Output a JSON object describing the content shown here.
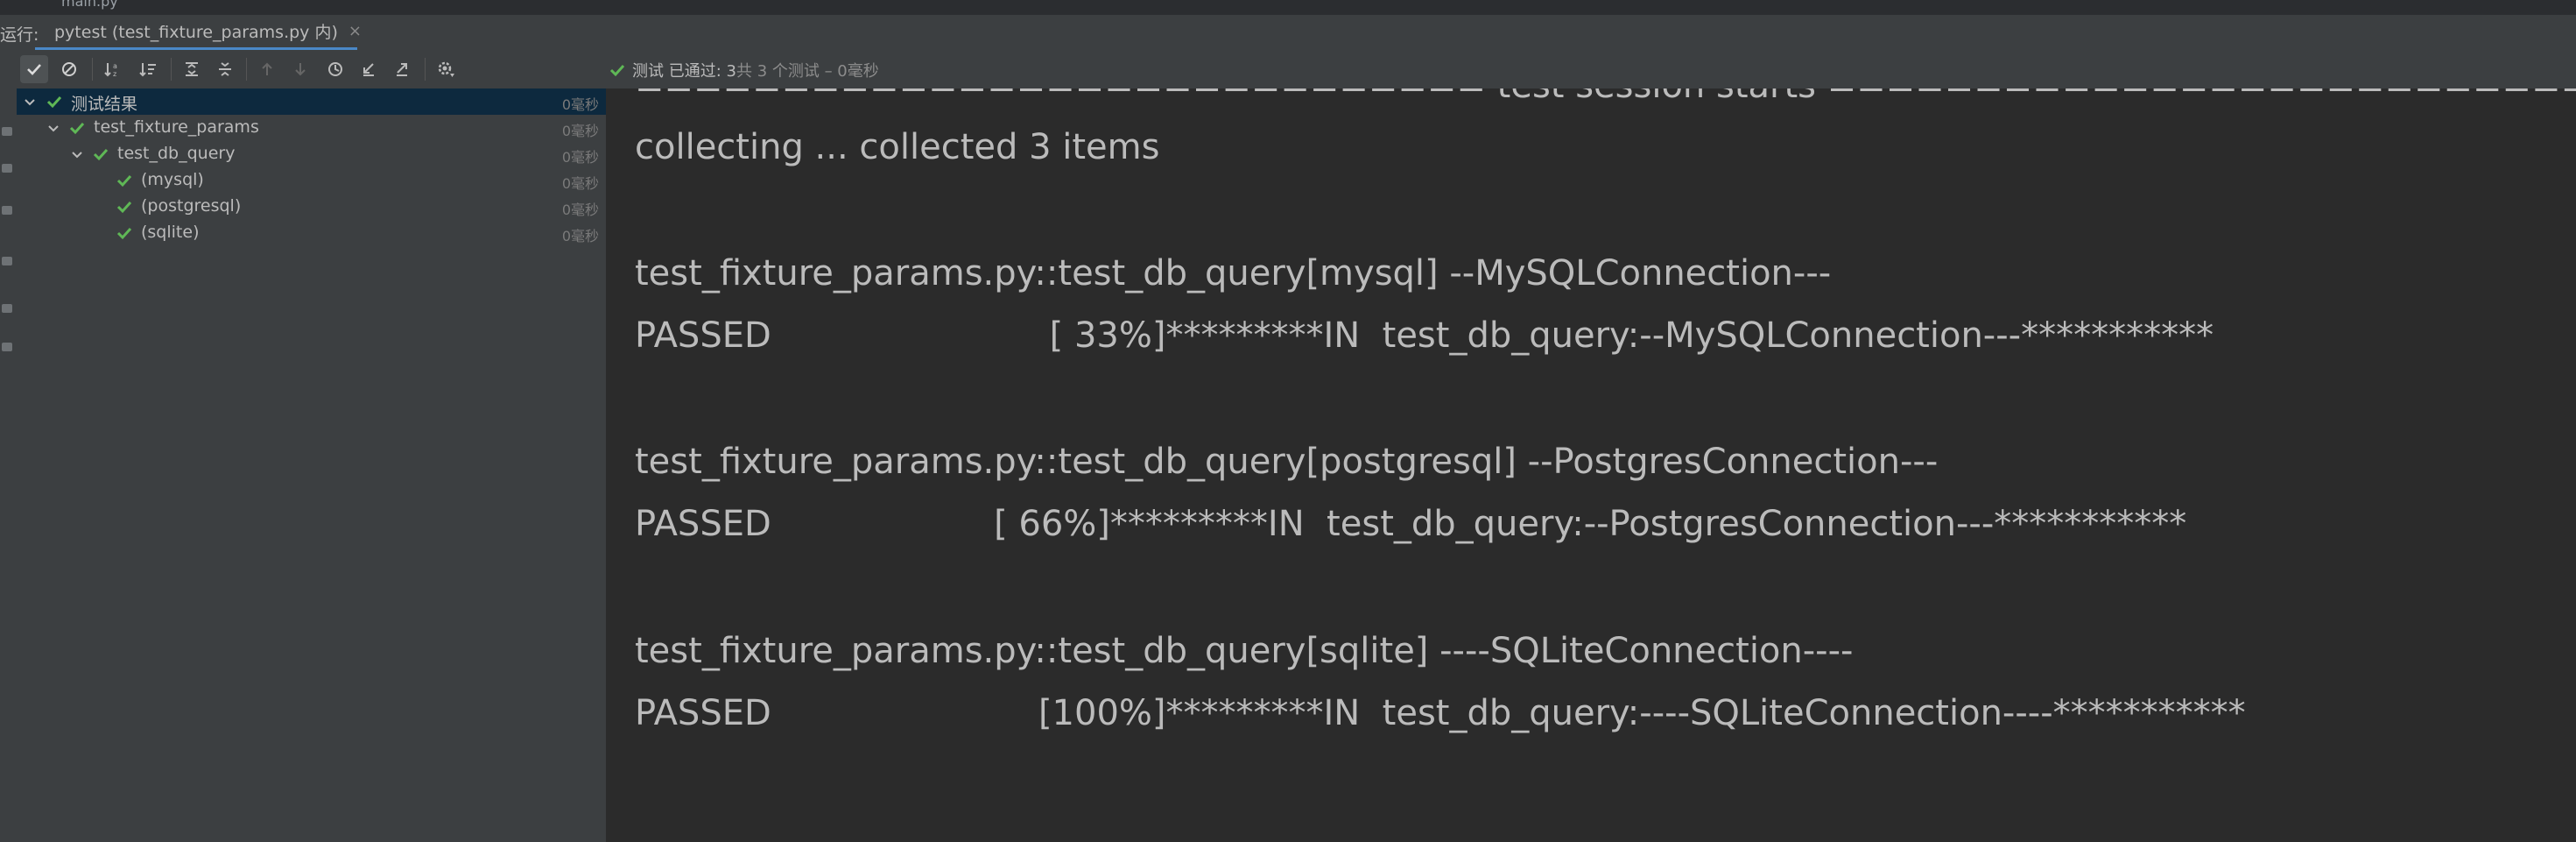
{
  "topstrip": {
    "file_label": "main.py"
  },
  "tabbar": {
    "run_label": "运行:",
    "tab": {
      "title": "pytest (test_fixture_params.py 内)",
      "close_glyph": "×"
    }
  },
  "toolbar": {
    "buttons": [
      {
        "name": "show-passed-icon"
      },
      {
        "name": "show-ignored-icon"
      },
      {
        "name": "sort-alphabetically-icon"
      },
      {
        "name": "sort-by-duration-icon"
      },
      {
        "name": "expand-all-icon"
      },
      {
        "name": "collapse-all-icon"
      },
      {
        "name": "previous-failed-icon"
      },
      {
        "name": "next-failed-icon"
      },
      {
        "name": "test-history-icon"
      },
      {
        "name": "import-tests-icon"
      },
      {
        "name": "export-results-icon"
      },
      {
        "name": "settings-icon"
      }
    ],
    "status": {
      "prefix": "测试 已通过: ",
      "count": "3",
      "total": "共 3 个测试 – 0毫秒"
    }
  },
  "tree": {
    "rows": [
      {
        "label": "测试结果",
        "time": "0毫秒"
      },
      {
        "label": "test_fixture_params",
        "time": "0毫秒"
      },
      {
        "label": "test_db_query",
        "time": "0毫秒"
      },
      {
        "label": "(mysql)",
        "time": "0毫秒"
      },
      {
        "label": "(postgresql)",
        "time": "0毫秒"
      },
      {
        "label": "(sqlite)",
        "time": "0毫秒"
      }
    ]
  },
  "console": {
    "lines": [
      "============================= test session starts ==============================",
      "collecting ... collected 3 items",
      "test_fixture_params.py::test_db_query[mysql] --MySQLConnection---",
      "PASSED                         [ 33%]*********IN  test_db_query:--MySQLConnection---***********",
      "test_fixture_params.py::test_db_query[postgresql] --PostgresConnection---",
      "PASSED                    [ 66%]*********IN  test_db_query:--PostgresConnection---***********",
      "test_fixture_params.py::test_db_query[sqlite] ----SQLiteConnection----",
      "PASSED                        [100%]*********IN  test_db_query:----SQLiteConnection----***********"
    ]
  },
  "colors": {
    "pass_green": "#5fb856",
    "accent_blue": "#4a88c7",
    "console_bg": "#2b2b2b",
    "panel_bg": "#3c3f41",
    "selected_bg": "#0d293e"
  }
}
